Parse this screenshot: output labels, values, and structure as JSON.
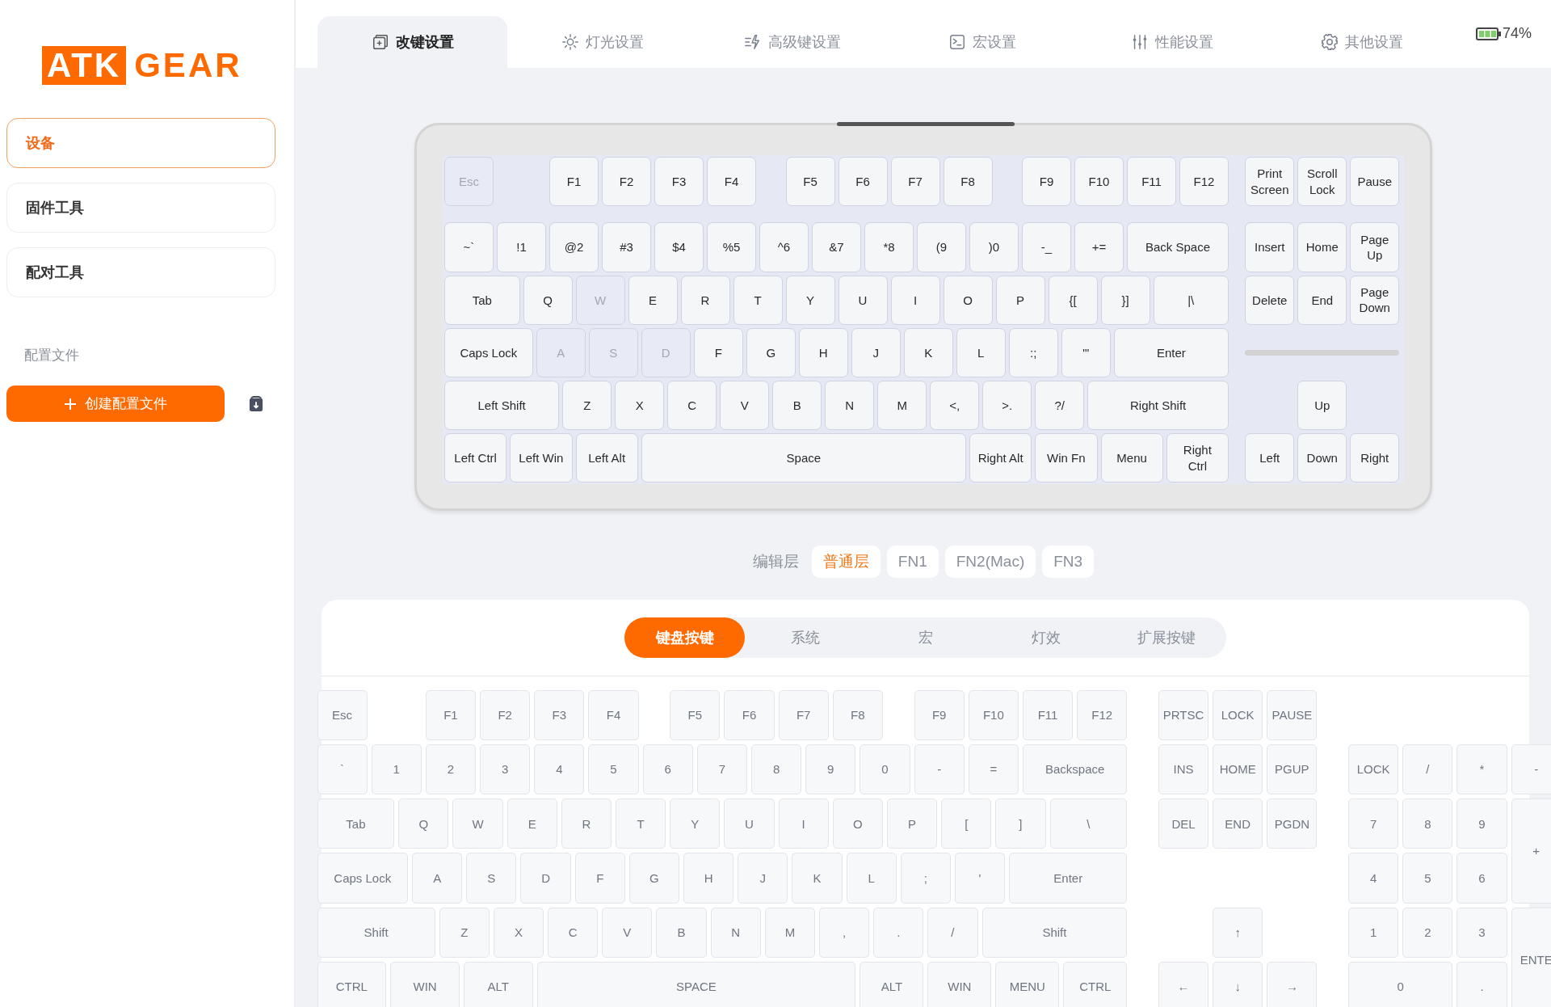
{
  "logo": {
    "mark": "ATK",
    "word": "GEAR"
  },
  "sidebar": {
    "items": [
      {
        "label": "设备",
        "selected": true
      },
      {
        "label": "固件工具",
        "selected": false
      },
      {
        "label": "配对工具",
        "selected": false
      }
    ],
    "profiles_label": "配置文件",
    "create_button": "创建配置文件"
  },
  "tabs": [
    {
      "label": "改键设置",
      "selected": true
    },
    {
      "label": "灯光设置",
      "selected": false
    },
    {
      "label": "高级键设置",
      "selected": false
    },
    {
      "label": "宏设置",
      "selected": false
    },
    {
      "label": "性能设置",
      "selected": false
    },
    {
      "label": "其他设置",
      "selected": false
    }
  ],
  "battery": {
    "text": "74%"
  },
  "keyboard": {
    "main_rows": [
      [
        {
          "label": "Esc",
          "dimmed": true
        },
        {
          "label": "F1",
          "dimmed": false
        },
        {
          "label": "F2",
          "dimmed": false
        },
        {
          "label": "F3",
          "dimmed": false
        },
        {
          "label": "F4",
          "dimmed": false
        },
        {
          "label": "F5",
          "dimmed": false
        },
        {
          "label": "F6",
          "dimmed": false
        },
        {
          "label": "F7",
          "dimmed": false
        },
        {
          "label": "F8",
          "dimmed": false
        },
        {
          "label": "F9",
          "dimmed": false
        },
        {
          "label": "F10",
          "dimmed": false
        },
        {
          "label": "F11",
          "dimmed": false
        },
        {
          "label": "F12",
          "dimmed": false
        }
      ],
      [
        {
          "label": "~`",
          "dimmed": false
        },
        {
          "label": "!1",
          "dimmed": false
        },
        {
          "label": "@2",
          "dimmed": false
        },
        {
          "label": "#3",
          "dimmed": false
        },
        {
          "label": "$4",
          "dimmed": false
        },
        {
          "label": "%5",
          "dimmed": false
        },
        {
          "label": "^6",
          "dimmed": false
        },
        {
          "label": "&7",
          "dimmed": false
        },
        {
          "label": "*8",
          "dimmed": false
        },
        {
          "label": "(9",
          "dimmed": false
        },
        {
          "label": ")0",
          "dimmed": false
        },
        {
          "label": "-_",
          "dimmed": false
        },
        {
          "label": "+=",
          "dimmed": false
        },
        {
          "label": "Back Space",
          "dimmed": false
        }
      ],
      [
        {
          "label": "Tab",
          "dimmed": false
        },
        {
          "label": "Q",
          "dimmed": false
        },
        {
          "label": "W",
          "dimmed": true
        },
        {
          "label": "E",
          "dimmed": false
        },
        {
          "label": "R",
          "dimmed": false
        },
        {
          "label": "T",
          "dimmed": false
        },
        {
          "label": "Y",
          "dimmed": false
        },
        {
          "label": "U",
          "dimmed": false
        },
        {
          "label": "I",
          "dimmed": false
        },
        {
          "label": "O",
          "dimmed": false
        },
        {
          "label": "P",
          "dimmed": false
        },
        {
          "label": "{[",
          "dimmed": false
        },
        {
          "label": "}]",
          "dimmed": false
        },
        {
          "label": "|\\",
          "dimmed": false
        }
      ],
      [
        {
          "label": "Caps Lock",
          "dimmed": false
        },
        {
          "label": "A",
          "dimmed": true
        },
        {
          "label": "S",
          "dimmed": true
        },
        {
          "label": "D",
          "dimmed": true
        },
        {
          "label": "F",
          "dimmed": false
        },
        {
          "label": "G",
          "dimmed": false
        },
        {
          "label": "H",
          "dimmed": false
        },
        {
          "label": "J",
          "dimmed": false
        },
        {
          "label": "K",
          "dimmed": false
        },
        {
          "label": "L",
          "dimmed": false
        },
        {
          "label": ":;",
          "dimmed": false
        },
        {
          "label": "\"'",
          "dimmed": false
        },
        {
          "label": "Enter",
          "dimmed": false
        }
      ],
      [
        {
          "label": "Left Shift",
          "dimmed": false
        },
        {
          "label": "Z",
          "dimmed": false
        },
        {
          "label": "X",
          "dimmed": false
        },
        {
          "label": "C",
          "dimmed": false
        },
        {
          "label": "V",
          "dimmed": false
        },
        {
          "label": "B",
          "dimmed": false
        },
        {
          "label": "N",
          "dimmed": false
        },
        {
          "label": "M",
          "dimmed": false
        },
        {
          "label": "<,",
          "dimmed": false
        },
        {
          "label": ">.",
          "dimmed": false
        },
        {
          "label": "?/",
          "dimmed": false
        },
        {
          "label": "Right Shift",
          "dimmed": false
        }
      ],
      [
        {
          "label": "Left Ctrl",
          "dimmed": false
        },
        {
          "label": "Left Win",
          "dimmed": false
        },
        {
          "label": "Left Alt",
          "dimmed": false
        },
        {
          "label": "Space",
          "dimmed": false
        },
        {
          "label": "Right Alt",
          "dimmed": false
        },
        {
          "label": "Win Fn",
          "dimmed": false
        },
        {
          "label": "Menu",
          "dimmed": false
        },
        {
          "label": "Right Ctrl",
          "dimmed": false
        }
      ]
    ],
    "nav_rows": [
      [
        {
          "label": "Print Screen",
          "dimmed": false
        },
        {
          "label": "Scroll Lock",
          "dimmed": false
        },
        {
          "label": "Pause",
          "dimmed": false
        }
      ],
      [
        {
          "label": "Insert",
          "dimmed": false
        },
        {
          "label": "Home",
          "dimmed": false
        },
        {
          "label": "Page Up",
          "dimmed": false
        }
      ],
      [
        {
          "label": "Delete",
          "dimmed": false
        },
        {
          "label": "End",
          "dimmed": false
        },
        {
          "label": "Page Down",
          "dimmed": false
        }
      ]
    ],
    "arrow_rows": [
      [
        "",
        {
          "label": "Up",
          "dimmed": false
        }
      ],
      [
        {
          "label": "Left",
          "dimmed": false
        },
        {
          "label": "Down",
          "dimmed": false
        },
        {
          "label": "Right",
          "dimmed": false
        }
      ]
    ]
  },
  "layer_selector": {
    "label": "编辑层",
    "layers": [
      {
        "label": "普通层",
        "selected": true
      },
      {
        "label": "FN1",
        "selected": false
      },
      {
        "label": "FN2(Mac)",
        "selected": false
      },
      {
        "label": "FN3",
        "selected": false
      }
    ]
  },
  "key_categories": [
    {
      "label": "键盘按键",
      "selected": true
    },
    {
      "label": "系统",
      "selected": false
    },
    {
      "label": "宏",
      "selected": false
    },
    {
      "label": "灯效",
      "selected": false
    },
    {
      "label": "扩展按键",
      "selected": false
    }
  ],
  "key_picker": {
    "main_rows": [
      [
        "Esc",
        "F1",
        "F2",
        "F3",
        "F4",
        "F5",
        "F6",
        "F7",
        "F8",
        "F9",
        "F10",
        "F11",
        "F12"
      ],
      [
        "`",
        "1",
        "2",
        "3",
        "4",
        "5",
        "6",
        "7",
        "8",
        "9",
        "0",
        "-",
        "=",
        "Backspace"
      ],
      [
        "Tab",
        "Q",
        "W",
        "E",
        "R",
        "T",
        "Y",
        "U",
        "I",
        "O",
        "P",
        "[",
        "]",
        "\\"
      ],
      [
        "Caps Lock",
        "A",
        "S",
        "D",
        "F",
        "G",
        "H",
        "J",
        "K",
        "L",
        ";",
        "'",
        "Enter"
      ],
      [
        "Shift",
        "Z",
        "X",
        "C",
        "V",
        "B",
        "N",
        "M",
        ",",
        ".",
        "/",
        "Shift"
      ],
      [
        "CTRL",
        "WIN",
        "ALT",
        "SPACE",
        "ALT",
        "WIN",
        "MENU",
        "CTRL"
      ]
    ],
    "nav_rows": [
      [
        "PRTSC",
        "LOCK",
        "PAUSE"
      ],
      [
        "INS",
        "HOME",
        "PGUP"
      ],
      [
        "DEL",
        "END",
        "PGDN"
      ]
    ],
    "arrow_rows": [
      [
        "",
        "↑"
      ],
      [
        "←",
        "↓",
        "→"
      ]
    ],
    "numpad_rows": [
      [
        "LOCK",
        "/",
        "*",
        "-"
      ],
      [
        "7",
        "8",
        "9",
        "+"
      ],
      [
        "4",
        "5",
        "6"
      ],
      [
        "1",
        "2",
        "3",
        "ENTE"
      ],
      [
        "0",
        "."
      ]
    ]
  }
}
